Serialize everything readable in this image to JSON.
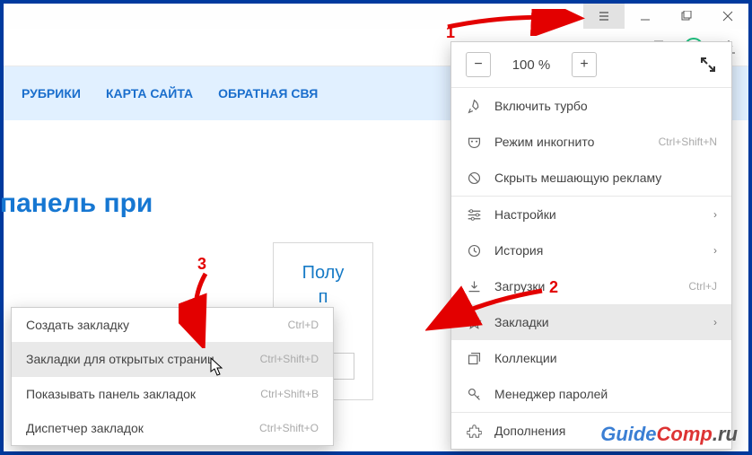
{
  "window": {
    "hamburger": "menu-icon",
    "minimize": "minimize-icon",
    "maximize": "maximize-icon",
    "close": "close-icon"
  },
  "toolbar": {
    "bookmark_icon": "bookmark-icon",
    "grammarly_letter": "G",
    "download_icon": "download-icon"
  },
  "page": {
    "nav": [
      "РУБРИКИ",
      "КАРТА САЙТА",
      "ОБРАТНАЯ СВЯ"
    ],
    "headline": "панель при",
    "widget_title_1": "Полу",
    "widget_title_2": "п"
  },
  "menu": {
    "zoom": {
      "minus": "−",
      "value": "100 %",
      "plus": "+",
      "fullscreen_icon": "fullscreen-icon"
    },
    "items": [
      {
        "icon": "rocket",
        "label": "Включить турбо"
      },
      {
        "icon": "mask",
        "label": "Режим инкогнито",
        "shortcut": "Ctrl+Shift+N"
      },
      {
        "icon": "block",
        "label": "Скрыть мешающую рекламу"
      }
    ],
    "items2": [
      {
        "icon": "sliders",
        "label": "Настройки",
        "arrow": true
      },
      {
        "icon": "clock",
        "label": "История",
        "arrow": true
      },
      {
        "icon": "download",
        "label": "Загрузки",
        "shortcut": "Ctrl+J"
      },
      {
        "icon": "star",
        "label": "Закладки",
        "arrow": true,
        "highlight": true
      },
      {
        "icon": "collections",
        "label": "Коллекции"
      },
      {
        "icon": "key",
        "label": "Менеджер паролей"
      }
    ],
    "items3": [
      {
        "icon": "puzzle",
        "label": "Дополнения"
      }
    ]
  },
  "submenu": [
    {
      "label": "Создать закладку",
      "shortcut": "Ctrl+D"
    },
    {
      "label": "Закладки для открытых страниц",
      "shortcut": "Ctrl+Shift+D",
      "highlight": true
    },
    {
      "label": "Показывать панель закладок",
      "shortcut": "Ctrl+Shift+B",
      "sep_before": true
    },
    {
      "label": "Диспетчер закладок",
      "shortcut": "Ctrl+Shift+O"
    }
  ],
  "annotations": {
    "n1": "1",
    "n2": "2",
    "n3": "3"
  },
  "watermark": {
    "a": "Guide",
    "b": "Comp",
    "c": ".ru"
  }
}
